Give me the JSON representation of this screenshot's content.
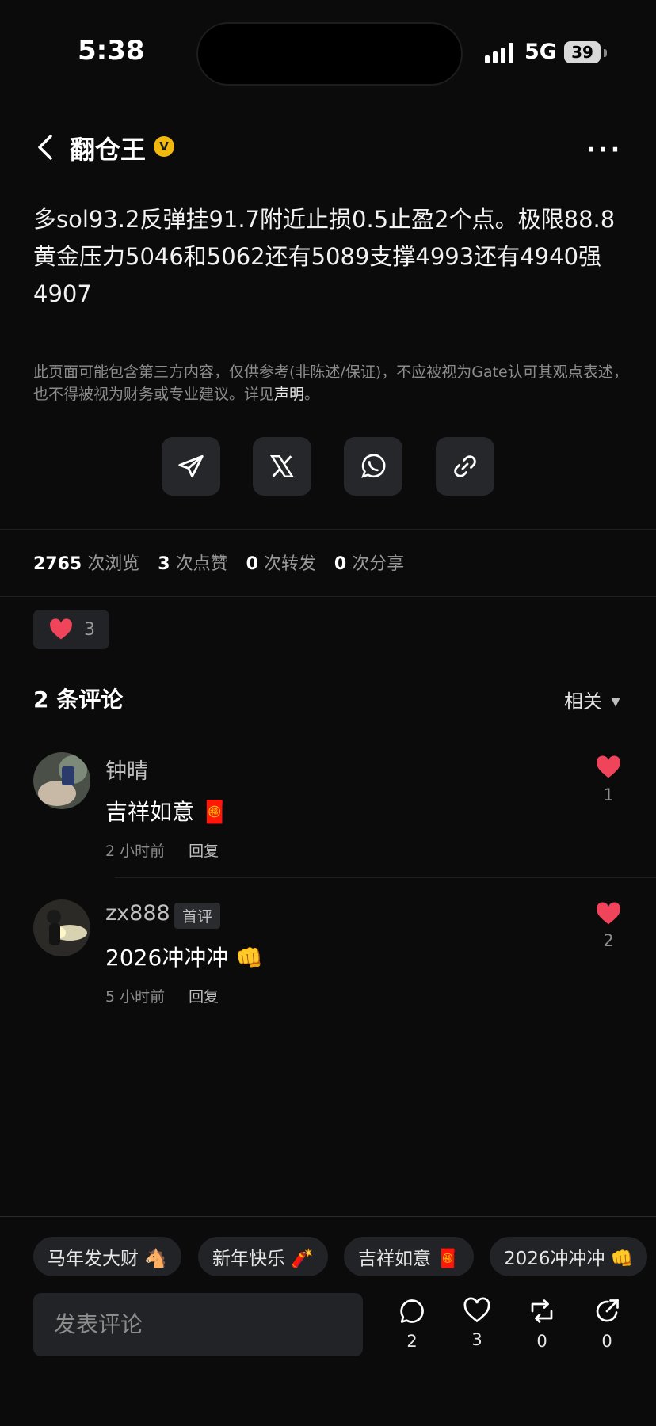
{
  "status_bar": {
    "time": "5:38",
    "network": "5G",
    "battery": "39"
  },
  "header": {
    "author": "翻仓王",
    "verified_icon": "verified-badge-icon",
    "more": "···"
  },
  "post": {
    "line1": "多sol93.2反弹挂91.7附近止损0.5止盈2个点。极限88.8",
    "line2": "黄金压力5046和5062还有5089支撑4993还有4940强4907",
    "disclaimer_text": "此页面可能包含第三方内容，仅供参考(非陈述/保证)，不应被视为Gate认可其观点表述，也不得被视为财务或专业建议。详见",
    "disclaimer_link": "声明",
    "disclaimer_end": "。"
  },
  "share_buttons": [
    "telegram-icon",
    "x-icon",
    "whatsapp-icon",
    "link-icon"
  ],
  "stats": {
    "views": "2765",
    "views_label": "次浏览",
    "likes": "3",
    "likes_label": "次点赞",
    "reposts": "0",
    "reposts_label": "次转发",
    "shares": "0",
    "shares_label": "次分享"
  },
  "reaction": {
    "count": "3"
  },
  "comments_section": {
    "title": "2 条评论",
    "sort": "相关"
  },
  "comments": [
    {
      "name": "钟晴",
      "text": "吉祥如意 🧧",
      "time": "2 小时前",
      "reply": "回复",
      "likes": "1",
      "badge": ""
    },
    {
      "name": "zx888",
      "text": "2026冲冲冲 👊",
      "time": "5 小时前",
      "reply": "回复",
      "likes": "2",
      "badge": "首评"
    }
  ],
  "quick_chips": [
    "马年发大财 🐴",
    "新年快乐 🧨",
    "吉祥如意 🧧",
    "2026冲冲冲 👊"
  ],
  "bottom_bar": {
    "placeholder": "发表评论",
    "comment_count": "2",
    "like_count": "3",
    "repost_count": "0",
    "share_count": "0"
  },
  "colors": {
    "accent": "#f0b90b",
    "like_red": "#f0445a",
    "background": "#0b0b0c"
  }
}
